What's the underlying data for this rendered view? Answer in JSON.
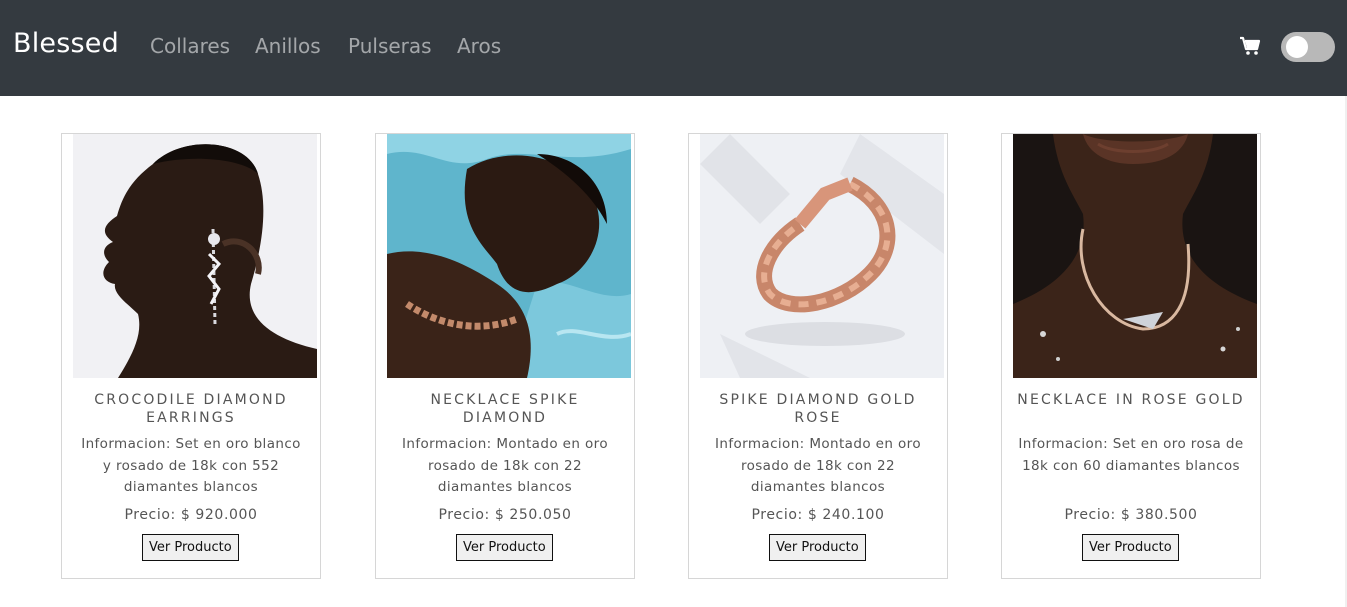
{
  "navbar": {
    "brand": "Blessed",
    "links": [
      "Collares",
      "Anillos",
      "Pulseras",
      "Aros"
    ],
    "cart_icon": "shopping-cart-icon",
    "theme_toggle": "dark-mode-toggle"
  },
  "products": [
    {
      "title": "CROCODILE DIAMOND EARRINGS",
      "info": "Informacion: Set en oro blanco y rosado de 18k con 552 diamantes blancos",
      "price": "Precio: $ 920.000",
      "button": "Ver Producto",
      "image": "woman-profile-earrings"
    },
    {
      "title": "NECKLACE SPIKE DIAMOND",
      "info": "Informacion: Montado en oro rosado de 18k con 22 diamantes blancos",
      "price": "Precio: $ 250.050",
      "button": "Ver Producto",
      "image": "woman-in-pool-necklace"
    },
    {
      "title": "SPIKE DIAMOND GOLD ROSE",
      "info": "Informacion: Montado en oro rosado de 18k con 22 diamantes blancos",
      "price": "Precio: $ 240.100",
      "button": "Ver Producto",
      "image": "rose-gold-bracelet"
    },
    {
      "title": "NECKLACE IN ROSE GOLD",
      "info": "Informacion: Set en oro rosa de 18k con 60 diamantes blancos",
      "price": "Precio: $ 380.500",
      "button": "Ver Producto",
      "image": "woman-neck-necklace"
    }
  ],
  "colors": {
    "navbar_bg": "#343a40",
    "brand": "#ffffff",
    "nav_link": "rgba(255,255,255,0.55)",
    "card_border": "#d6d6d6"
  }
}
